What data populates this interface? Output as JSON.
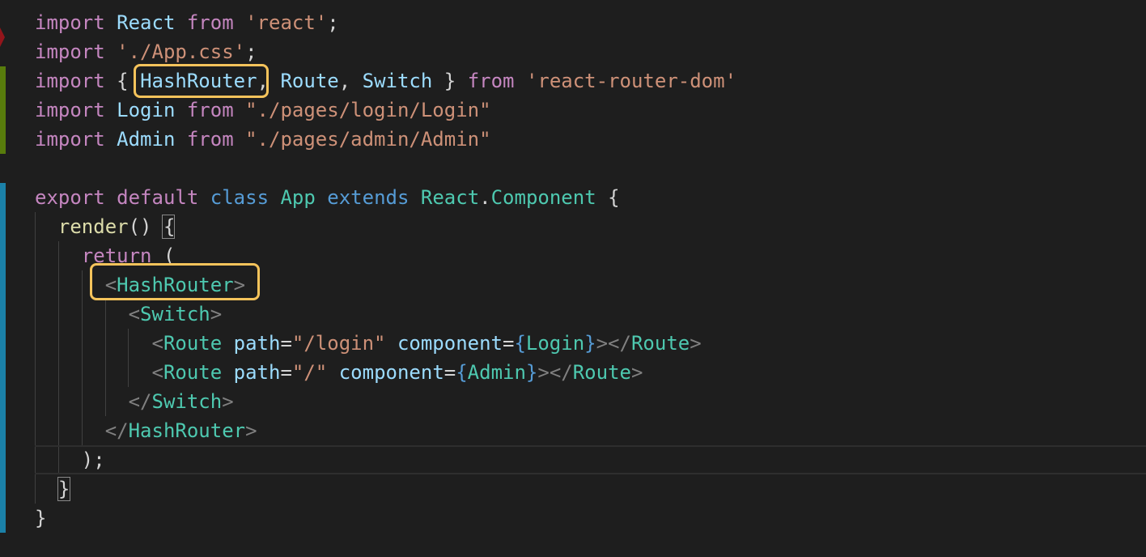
{
  "editor": {
    "lines": [
      [
        {
          "t": "import",
          "c": "k"
        },
        {
          "t": " ",
          "c": "p"
        },
        {
          "t": "React",
          "c": "v"
        },
        {
          "t": " ",
          "c": "p"
        },
        {
          "t": "from",
          "c": "k"
        },
        {
          "t": " ",
          "c": "p"
        },
        {
          "t": "'react'",
          "c": "s"
        },
        {
          "t": ";",
          "c": "p"
        }
      ],
      [
        {
          "t": "import",
          "c": "k"
        },
        {
          "t": " ",
          "c": "p"
        },
        {
          "t": "'./App.css'",
          "c": "s"
        },
        {
          "t": ";",
          "c": "p"
        }
      ],
      [
        {
          "t": "import",
          "c": "k"
        },
        {
          "t": " { ",
          "c": "p"
        },
        {
          "t": "HashRouter",
          "c": "v"
        },
        {
          "t": ", ",
          "c": "p"
        },
        {
          "t": "Route",
          "c": "v"
        },
        {
          "t": ", ",
          "c": "p"
        },
        {
          "t": "Switch",
          "c": "v"
        },
        {
          "t": " } ",
          "c": "p"
        },
        {
          "t": "from",
          "c": "k"
        },
        {
          "t": " ",
          "c": "p"
        },
        {
          "t": "'react-router-dom'",
          "c": "s"
        }
      ],
      [
        {
          "t": "import",
          "c": "k"
        },
        {
          "t": " ",
          "c": "p"
        },
        {
          "t": "Login",
          "c": "v"
        },
        {
          "t": " ",
          "c": "p"
        },
        {
          "t": "from",
          "c": "k"
        },
        {
          "t": " ",
          "c": "p"
        },
        {
          "t": "\"./pages/login/Login\"",
          "c": "s"
        }
      ],
      [
        {
          "t": "import",
          "c": "k"
        },
        {
          "t": " ",
          "c": "p"
        },
        {
          "t": "Admin",
          "c": "v"
        },
        {
          "t": " ",
          "c": "p"
        },
        {
          "t": "from",
          "c": "k"
        },
        {
          "t": " ",
          "c": "p"
        },
        {
          "t": "\"./pages/admin/Admin\"",
          "c": "s"
        }
      ],
      [],
      [
        {
          "t": "export",
          "c": "k"
        },
        {
          "t": " ",
          "c": "p"
        },
        {
          "t": "default",
          "c": "k"
        },
        {
          "t": " ",
          "c": "p"
        },
        {
          "t": "class",
          "c": "kb"
        },
        {
          "t": " ",
          "c": "p"
        },
        {
          "t": "App",
          "c": "c"
        },
        {
          "t": " ",
          "c": "p"
        },
        {
          "t": "extends",
          "c": "kb"
        },
        {
          "t": " ",
          "c": "p"
        },
        {
          "t": "React",
          "c": "c"
        },
        {
          "t": ".",
          "c": "p"
        },
        {
          "t": "Component",
          "c": "c"
        },
        {
          "t": " {",
          "c": "p"
        }
      ],
      [
        {
          "t": "  ",
          "c": "p"
        },
        {
          "t": "render",
          "c": "f"
        },
        {
          "t": "() {",
          "c": "p"
        }
      ],
      [
        {
          "t": "    ",
          "c": "p"
        },
        {
          "t": "return",
          "c": "k"
        },
        {
          "t": " (",
          "c": "p"
        }
      ],
      [
        {
          "t": "      ",
          "c": "p"
        },
        {
          "t": "<",
          "c": "g"
        },
        {
          "t": "HashRouter",
          "c": "c"
        },
        {
          "t": ">",
          "c": "g"
        }
      ],
      [
        {
          "t": "        ",
          "c": "p"
        },
        {
          "t": "<",
          "c": "g"
        },
        {
          "t": "Switch",
          "c": "c"
        },
        {
          "t": ">",
          "c": "g"
        }
      ],
      [
        {
          "t": "          ",
          "c": "p"
        },
        {
          "t": "<",
          "c": "g"
        },
        {
          "t": "Route",
          "c": "c"
        },
        {
          "t": " ",
          "c": "p"
        },
        {
          "t": "path",
          "c": "v"
        },
        {
          "t": "=",
          "c": "p"
        },
        {
          "t": "\"/login\"",
          "c": "s"
        },
        {
          "t": " ",
          "c": "p"
        },
        {
          "t": "component",
          "c": "v"
        },
        {
          "t": "=",
          "c": "p"
        },
        {
          "t": "{",
          "c": "kb"
        },
        {
          "t": "Login",
          "c": "c"
        },
        {
          "t": "}",
          "c": "kb"
        },
        {
          "t": "></",
          "c": "g"
        },
        {
          "t": "Route",
          "c": "c"
        },
        {
          "t": ">",
          "c": "g"
        }
      ],
      [
        {
          "t": "          ",
          "c": "p"
        },
        {
          "t": "<",
          "c": "g"
        },
        {
          "t": "Route",
          "c": "c"
        },
        {
          "t": " ",
          "c": "p"
        },
        {
          "t": "path",
          "c": "v"
        },
        {
          "t": "=",
          "c": "p"
        },
        {
          "t": "\"/\"",
          "c": "s"
        },
        {
          "t": " ",
          "c": "p"
        },
        {
          "t": "component",
          "c": "v"
        },
        {
          "t": "=",
          "c": "p"
        },
        {
          "t": "{",
          "c": "kb"
        },
        {
          "t": "Admin",
          "c": "c"
        },
        {
          "t": "}",
          "c": "kb"
        },
        {
          "t": "></",
          "c": "g"
        },
        {
          "t": "Route",
          "c": "c"
        },
        {
          "t": ">",
          "c": "g"
        }
      ],
      [
        {
          "t": "        ",
          "c": "p"
        },
        {
          "t": "</",
          "c": "g"
        },
        {
          "t": "Switch",
          "c": "c"
        },
        {
          "t": ">",
          "c": "g"
        }
      ],
      [
        {
          "t": "      ",
          "c": "p"
        },
        {
          "t": "</",
          "c": "g"
        },
        {
          "t": "HashRouter",
          "c": "c"
        },
        {
          "t": ">",
          "c": "g"
        }
      ],
      [
        {
          "t": "    );",
          "c": "p"
        }
      ],
      [
        {
          "t": "  }",
          "c": "p"
        }
      ],
      [
        {
          "t": "}",
          "c": "p"
        }
      ]
    ]
  },
  "colors": {
    "background": "#1e1e1e",
    "highlight": "#f5c35b",
    "gutter_modified": "#1b81a8",
    "gutter_added": "#587c0c",
    "gutter_deleted": "#94151b"
  }
}
